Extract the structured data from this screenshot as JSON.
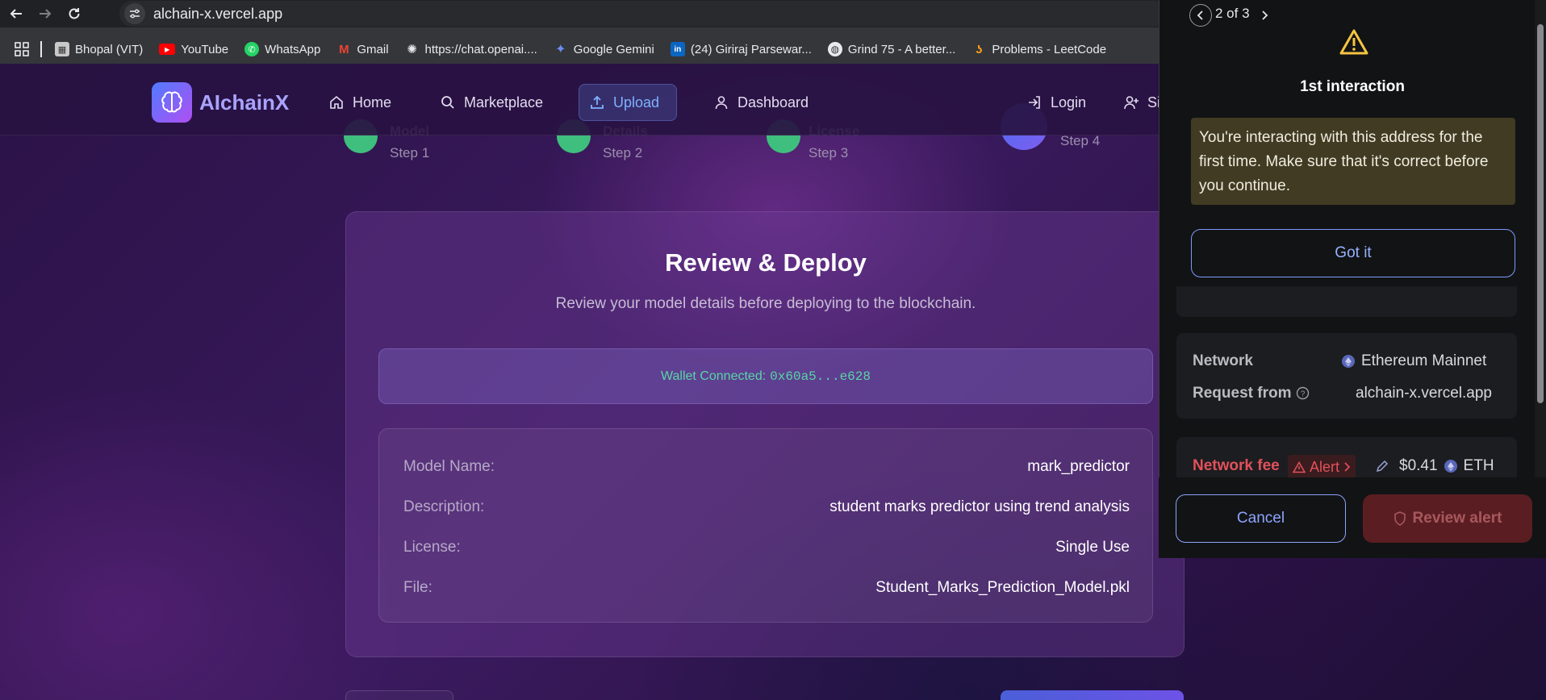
{
  "browser": {
    "url": "alchain-x.vercel.app",
    "bookmarks": [
      {
        "label": "Bhopal (VIT)",
        "icon": "university-icon"
      },
      {
        "label": "YouTube",
        "icon": "youtube-icon"
      },
      {
        "label": "WhatsApp",
        "icon": "whatsapp-icon"
      },
      {
        "label": "Gmail",
        "icon": "gmail-icon"
      },
      {
        "label": "https://chat.openai....",
        "icon": "openai-icon"
      },
      {
        "label": "Google Gemini",
        "icon": "gemini-icon"
      },
      {
        "label": "(24) Giriraj Parsewar...",
        "icon": "linkedin-icon"
      },
      {
        "label": "Grind 75 - A better...",
        "icon": "globe-icon"
      },
      {
        "label": "Problems - LeetCode",
        "icon": "leetcode-icon"
      }
    ]
  },
  "site": {
    "brand": "AIchainX",
    "nav": {
      "home": "Home",
      "marketplace": "Marketplace",
      "upload": "Upload",
      "dashboard": "Dashboard",
      "login": "Login",
      "signup": "Si"
    },
    "steps": [
      {
        "title": "Model",
        "sub": "Step 1"
      },
      {
        "title": "Details",
        "sub": "Step 2"
      },
      {
        "title": "License",
        "sub": "Step 3"
      },
      {
        "title": "",
        "sub": "Step 4"
      }
    ],
    "card": {
      "title": "Review & Deploy",
      "subtitle": "Review your model details before deploying to the blockchain.",
      "wallet_label": "Wallet Connected:",
      "wallet_address": "0x60a5...e628",
      "details": [
        {
          "key": "Model Name:",
          "value": "mark_predictor"
        },
        {
          "key": "Description:",
          "value": "student marks predictor using trend analysis"
        },
        {
          "key": "License:",
          "value": "Single Use"
        },
        {
          "key": "File:",
          "value": "Student_Marks_Prediction_Model.pkl"
        }
      ]
    }
  },
  "wallet_popup": {
    "pager": "2 of 3",
    "title": "1st interaction",
    "notice": "You're interacting with this address for the first time. Make sure that it's correct before you continue.",
    "got_it": "Got it",
    "network_label": "Network",
    "network_value": "Ethereum Mainnet",
    "request_label": "Request from",
    "request_value": "alchain-x.vercel.app",
    "fee_label": "Network fee",
    "fee_alert": "Alert",
    "fee_value": "$0.41",
    "fee_currency": "ETH",
    "cancel": "Cancel",
    "review_alert": "Review alert",
    "colors": {
      "alert": "#e2515b",
      "link": "#8da4ff",
      "warning_bg": "#403b22"
    }
  }
}
